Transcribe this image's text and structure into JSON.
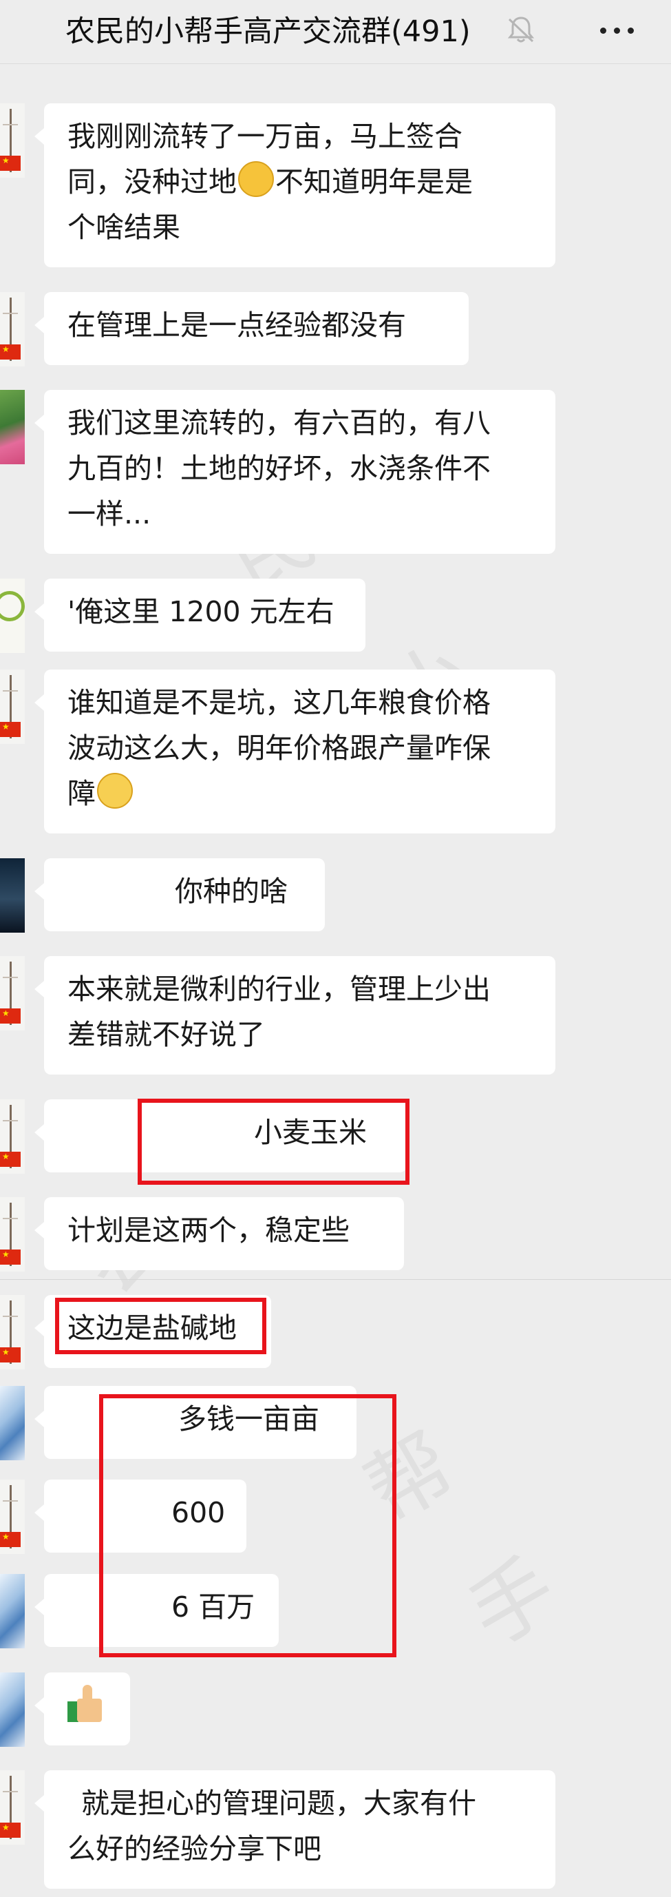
{
  "header": {
    "title": "农民的小帮手高产交流群(491)",
    "mute_icon": "bell-muted-icon",
    "more_icon": "more-dots-icon"
  },
  "messages": [
    {
      "avatar": "flag",
      "lines": [
        "我刚刚流转了一万亩，马上签合",
        "同，没种过地",
        "不知道明年是是",
        "个啥结果"
      ],
      "emoji": "thinking-face"
    },
    {
      "avatar": "flag",
      "text": "在管理上是一点经验都没有"
    },
    {
      "avatar": "lotus",
      "lines": [
        "我们这里流转的，有六百的，有八",
        "九百的！土地的好坏，水浇条件不",
        "一样..."
      ]
    },
    {
      "avatar": "green",
      "text": "'俺这里 1200 元左右"
    },
    {
      "avatar": "flag",
      "lines": [
        "谁知道是不是坑，这几年粮食价格",
        "波动这么大，明年价格跟产量咋保",
        "障"
      ],
      "emoji": "woozy-face"
    },
    {
      "avatar": "dark",
      "text": "你种的啥"
    },
    {
      "avatar": "flag",
      "lines": [
        "本来就是微利的行业，管理上少出",
        "差错就不好说了"
      ]
    },
    {
      "avatar": "flag",
      "text": "小麦玉米"
    },
    {
      "avatar": "flag",
      "text": "计划是这两个，稳定些"
    },
    {
      "avatar": "flag",
      "text": "这边是盐碱地"
    },
    {
      "avatar": "sky",
      "text": "多钱一亩亩"
    },
    {
      "avatar": "flag",
      "text": "600"
    },
    {
      "avatar": "sky",
      "text": "6 百万"
    },
    {
      "avatar": "sky",
      "emoji": "thumbs-up"
    },
    {
      "avatar": "flag",
      "lines": [
        "就是担心的管理问题，大家有什",
        "么好的经验分享下吧"
      ]
    }
  ],
  "highlight_color": "#e8141c"
}
